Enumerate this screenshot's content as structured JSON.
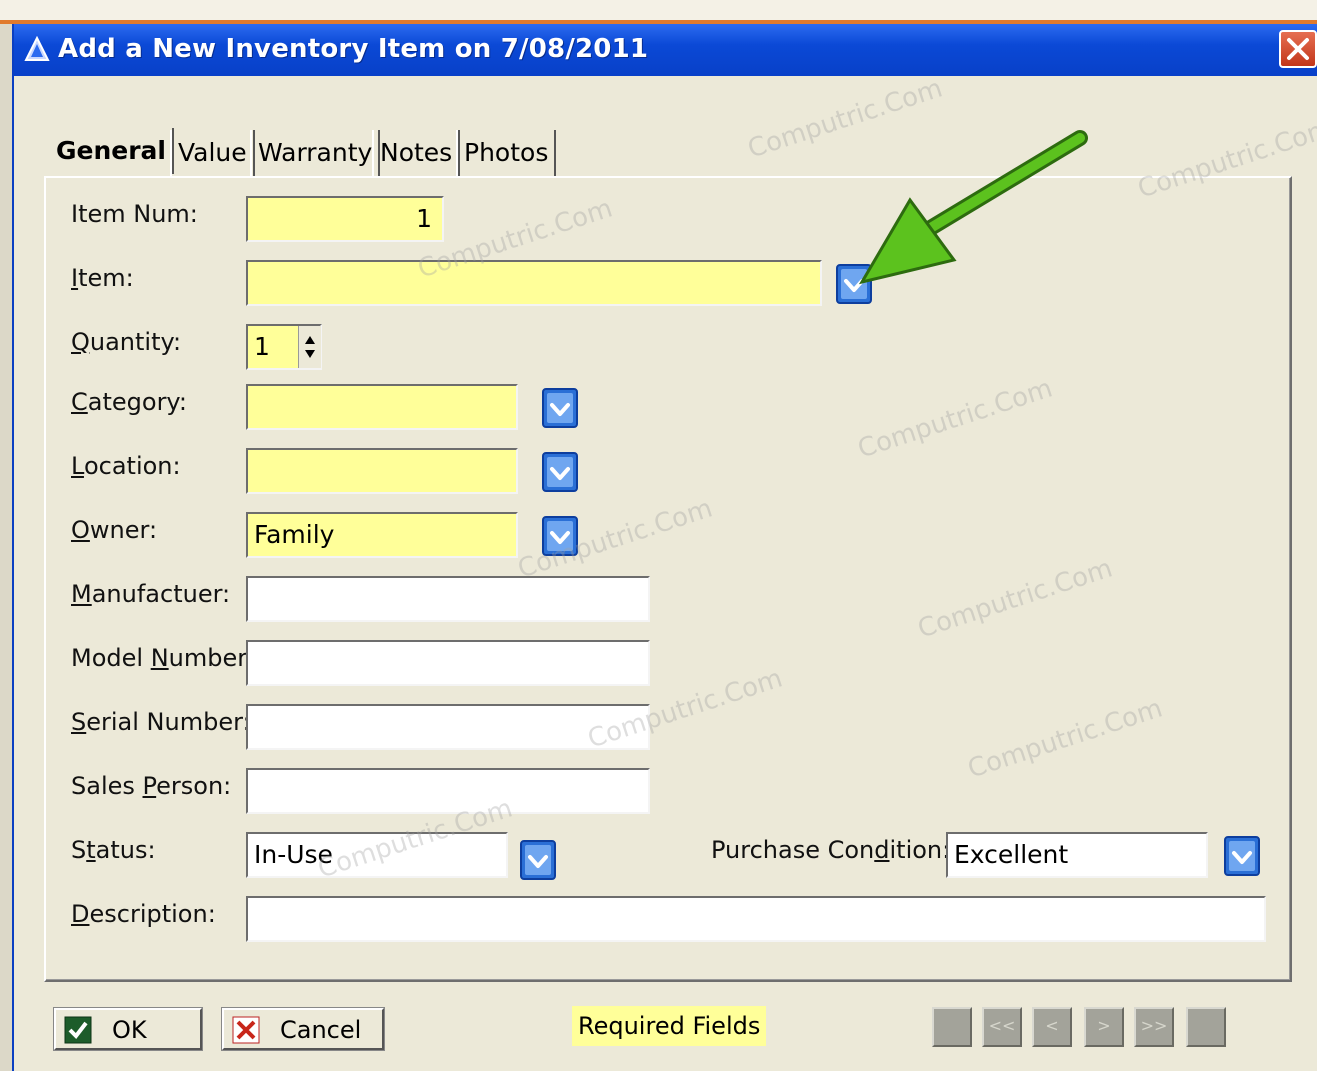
{
  "window": {
    "title": "Add a New Inventory Item on 7/08/2011"
  },
  "tabs": [
    "General",
    "Value",
    "Warranty",
    "Notes",
    "Photos"
  ],
  "fields": {
    "item_num": {
      "label": "Item Num:",
      "value": "1"
    },
    "item": {
      "label_pre": "",
      "label_u": "I",
      "label_post": "tem:",
      "value": ""
    },
    "quantity": {
      "label_pre": "",
      "label_u": "Q",
      "label_post": "uantity:",
      "value": "1"
    },
    "category": {
      "label_pre": "",
      "label_u": "C",
      "label_post": "ategory:",
      "value": ""
    },
    "location": {
      "label_pre": "",
      "label_u": "L",
      "label_post": "ocation:",
      "value": ""
    },
    "owner": {
      "label_pre": "",
      "label_u": "O",
      "label_post": "wner:",
      "value": "Family"
    },
    "manufacturer": {
      "label_pre": "",
      "label_u": "M",
      "label_post": "anufactuer:",
      "value": ""
    },
    "model_number": {
      "label_pre": "Model ",
      "label_u": "N",
      "label_post": "umber:",
      "value": ""
    },
    "serial_number": {
      "label_pre": "",
      "label_u": "S",
      "label_post": "erial Number:",
      "value": ""
    },
    "sales_person": {
      "label_pre": "Sales ",
      "label_u": "P",
      "label_post": "erson:",
      "value": ""
    },
    "status": {
      "label_pre": "S",
      "label_u": "t",
      "label_post": "atus:",
      "value": "In-Use"
    },
    "purchase_condition": {
      "label_pre": "Purchase Con",
      "label_u": "d",
      "label_post": "ition:",
      "value": "Excellent"
    },
    "description": {
      "label_pre": "",
      "label_u": "D",
      "label_post": "escription:",
      "value": ""
    }
  },
  "buttons": {
    "ok": "OK",
    "cancel": "Cancel"
  },
  "required_note": "Required Fields",
  "nav_buttons": [
    "",
    "<<",
    "<",
    ">",
    ">>",
    ""
  ],
  "watermark": "Computric.Com",
  "colors": {
    "required": "#ffff99",
    "titlebar": "#0b49d6",
    "arrow": "#5cc21e"
  }
}
